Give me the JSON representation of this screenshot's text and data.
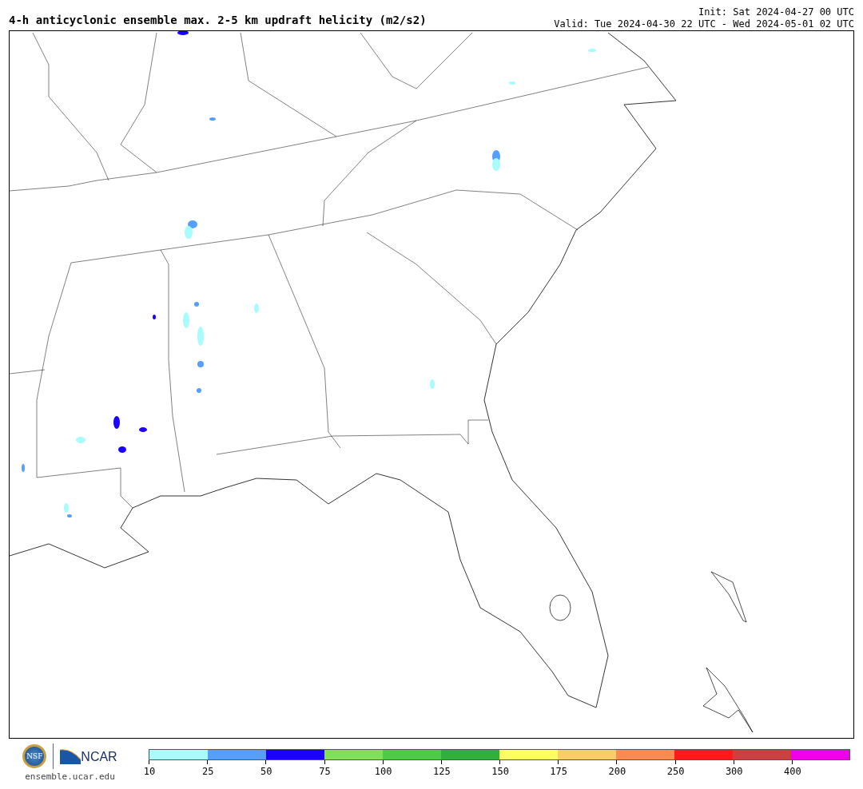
{
  "header": {
    "title": "4-h anticyclonic ensemble max. 2-5 km updraft helicity (m2/s2)",
    "init": "Init: Sat 2024-04-27 00 UTC",
    "valid": "Valid: Tue 2024-04-30 22 UTC - Wed 2024-05-01 02 UTC"
  },
  "footer": {
    "logos": [
      {
        "kind": "nsf",
        "text": "NSF"
      },
      {
        "kind": "ncar",
        "text": "NCAR"
      }
    ],
    "url": "ensemble.ucar.edu"
  },
  "legend": {
    "bins": [
      {
        "color": "#a8fcfc"
      },
      {
        "color": "#55a0ff"
      },
      {
        "color": "#1a00ff"
      },
      {
        "color": "#80e05a"
      },
      {
        "color": "#4ccc44"
      },
      {
        "color": "#2eb03a"
      },
      {
        "color": "#ffff60"
      },
      {
        "color": "#ffcc66"
      },
      {
        "color": "#ff8a50"
      },
      {
        "color": "#ff1a1a"
      },
      {
        "color": "#cc4040"
      },
      {
        "color": "#ee00ee"
      }
    ],
    "ticks": [
      "10",
      "25",
      "50",
      "75",
      "100",
      "125",
      "150",
      "175",
      "200",
      "250",
      "300",
      "400"
    ]
  }
}
